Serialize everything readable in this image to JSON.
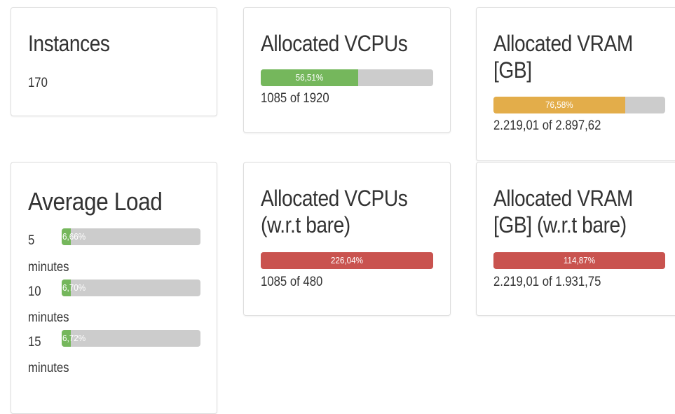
{
  "colors": {
    "green": "#75b75c",
    "orange": "#e3ad4a",
    "red": "#c9534f",
    "track": "#cccccc"
  },
  "instances": {
    "title": "Instances",
    "value": "170"
  },
  "vcpus": {
    "title": "Allocated VCPUs",
    "percent_label": "56,51%",
    "percent": 56.51,
    "summary": "1085 of 1920"
  },
  "vram": {
    "title_line1": "Allocated VRAM",
    "title_line2": "[GB]",
    "percent_label": "76,58%",
    "percent": 76.58,
    "summary": "2.219,01 of 2.897,62"
  },
  "load": {
    "title": "Average Load",
    "rows": [
      {
        "num": "5",
        "unit": "minutes",
        "percent_label": "6,66%",
        "percent": 6.66
      },
      {
        "num": "10",
        "unit": "minutes",
        "percent_label": "6,70%",
        "percent": 6.7
      },
      {
        "num": "15",
        "unit": "minutes",
        "percent_label": "6,72%",
        "percent": 6.72
      }
    ]
  },
  "vcpus_bare": {
    "title_line1": "Allocated VCPUs",
    "title_line2": "(w.r.t bare)",
    "percent_label": "226,04%",
    "percent": 226.04,
    "summary": "1085 of 480"
  },
  "vram_bare": {
    "title_line1": "Allocated VRAM",
    "title_line2": "[GB] (w.r.t bare)",
    "percent_label": "114,87%",
    "percent": 114.87,
    "summary": "2.219,01 of 1.931,75"
  }
}
